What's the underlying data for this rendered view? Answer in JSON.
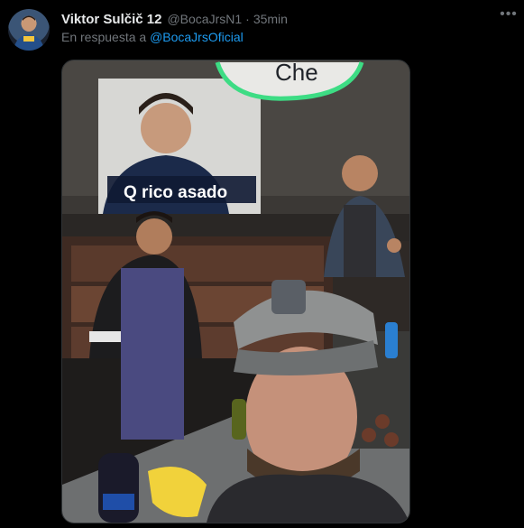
{
  "tweet": {
    "display_name": "Viktor Sulčič 12",
    "handle": "@BocaJrsN1",
    "separator": "·",
    "time": "35min",
    "reply_prefix": "En respuesta a",
    "reply_mention": "@BocaJrsOficial",
    "more_icon": "more-horizontal-icon",
    "more_glyph": "•••"
  },
  "media": {
    "speech_bubble_text": "Che",
    "inset_caption": "Q rico asado",
    "accent_green": "#3ddc84"
  },
  "colors": {
    "background": "#000000",
    "text_primary": "#e7e9ea",
    "text_secondary": "#71767b",
    "link": "#1d9bf0"
  }
}
